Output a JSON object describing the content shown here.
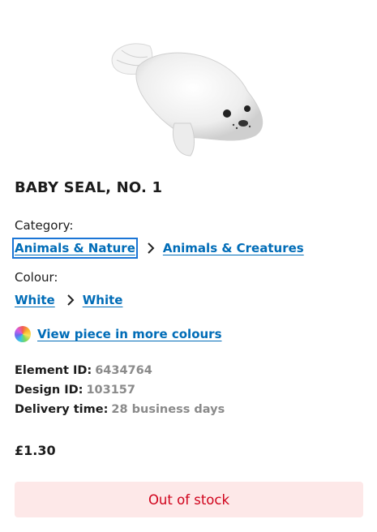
{
  "product": {
    "title": "BABY SEAL, NO. 1",
    "image_icon": "seal-image"
  },
  "category": {
    "label": "Category:",
    "crumbs": [
      "Animals & Nature",
      "Animals & Creatures"
    ]
  },
  "colour": {
    "label": "Colour:",
    "crumbs": [
      "White",
      "White"
    ]
  },
  "more_colours": {
    "icon": "colour-wheel-icon",
    "link": "View piece in more colours"
  },
  "specs": {
    "element_id_label": "Element ID:",
    "element_id": "6434764",
    "design_id_label": "Design ID:",
    "design_id": "103157",
    "delivery_label": "Delivery time:",
    "delivery": "28 business days"
  },
  "price": "£1.30",
  "stock": {
    "status": "Out of stock",
    "bg_color": "#fde8e8",
    "text_color": "#d0021b"
  },
  "colors": {
    "link": "#006cb7",
    "muted": "#8a8a8a"
  }
}
